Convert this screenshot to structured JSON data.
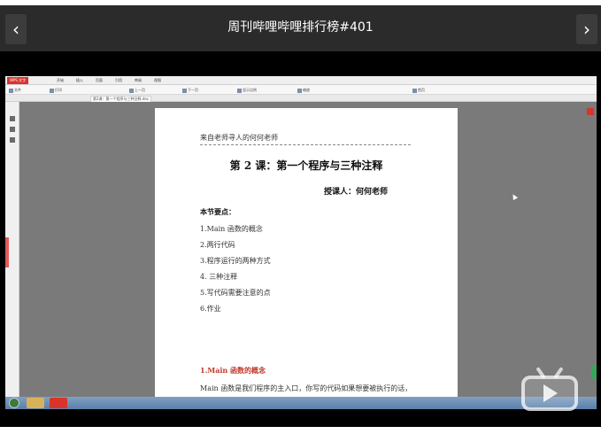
{
  "header": {
    "title": "周刊哔哩哔哩排行榜#401",
    "prev_label": "‹",
    "next_label": "›"
  },
  "wps": {
    "logo": "WPS 文字",
    "menu": [
      "开始",
      "插入",
      "页面",
      "引用",
      "审阅",
      "视图"
    ],
    "toolbar": [
      "文件",
      "打印",
      "上一页",
      "下一页",
      "显示比例",
      "缩放",
      "首页"
    ],
    "tab": "第2课：第一个程序与三种注释.doc"
  },
  "document": {
    "header_line": "来自老师寻人的何何老师",
    "title": "第 2 课：第一个程序与三种注释",
    "author": "授课人：何何老师",
    "section_title": "本节要点：",
    "points": [
      "1.Main 函数的概念",
      "2.两行代码",
      "3.程序运行的两种方式",
      "4. 三种注释",
      "5.写代码需要注意的点",
      "6.作业"
    ],
    "heading1": "1.Main 函数的概念",
    "para": "Main 函数是我们程序的主入口，你写的代码如果想要被执行的话，"
  },
  "colors": {
    "topbar": "#2b2b2b",
    "video_bg": "#000000",
    "accent_red": "#c0392b"
  },
  "icons": {
    "prev": "chevron-left-icon",
    "next": "chevron-right-icon",
    "watermark": "play-tv-icon"
  }
}
